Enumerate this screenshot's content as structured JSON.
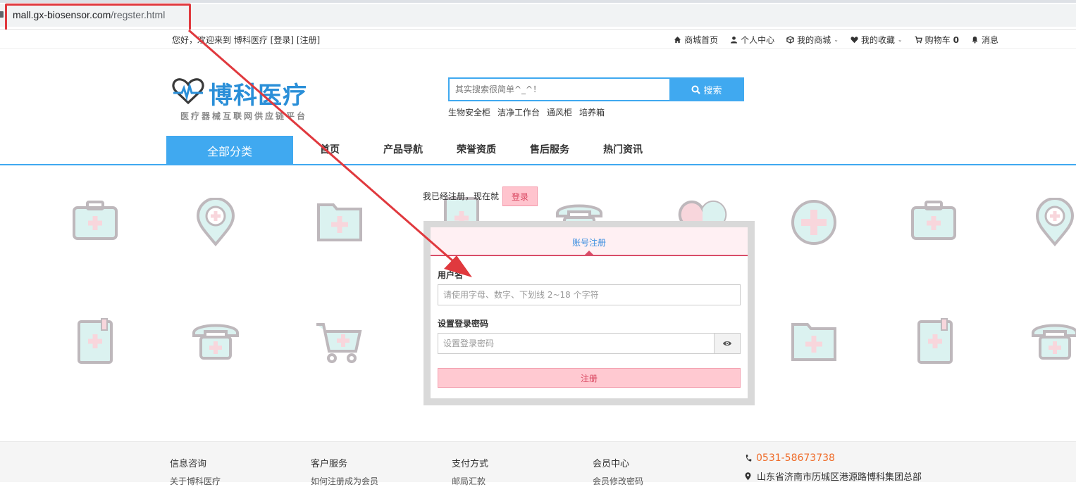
{
  "browser": {
    "url_host": "mall.gx-biosensor.com",
    "url_path": "/regster.html"
  },
  "topbar": {
    "welcome": "您好，欢迎来到 博科医疗",
    "login_link": "[登录]",
    "register_link": "[注册]",
    "nav": [
      {
        "label": "商城首页",
        "icon": "home-icon"
      },
      {
        "label": "个人中心",
        "icon": "user-icon"
      },
      {
        "label": "我的商城",
        "icon": "cube-icon"
      },
      {
        "label": "我的收藏",
        "icon": "heart-icon"
      },
      {
        "label": "购物车",
        "icon": "cart-icon",
        "count": "0"
      },
      {
        "label": "消息",
        "icon": "bell-icon"
      }
    ]
  },
  "header": {
    "logo_name": "博科医疗",
    "logo_slogan": "医疗器械互联网供应链平台",
    "search_placeholder": "其实搜索很简单^_^！",
    "search_button": "搜索",
    "hot_words": [
      "生物安全柜",
      "洁净工作台",
      "通风柜",
      "培养箱"
    ]
  },
  "nav": {
    "all_categories": "全部分类",
    "links": [
      "首页",
      "产品导航",
      "荣誉资质",
      "售后服务",
      "热门资讯"
    ]
  },
  "register": {
    "already_text": "我已经注册，现在就",
    "login_button": "登录",
    "tab": "账号注册",
    "username_label": "用户名",
    "username_placeholder": "请使用字母、数字、下划线 2~18 个字符",
    "password_label": "设置登录密码",
    "password_placeholder": "设置登录密码",
    "submit": "注册"
  },
  "footer": {
    "columns": [
      {
        "title": "信息咨询",
        "first_link": "关于博科医疗"
      },
      {
        "title": "客户服务",
        "first_link": "如何注册成为会员"
      },
      {
        "title": "支付方式",
        "first_link": "邮局汇款"
      },
      {
        "title": "会员中心",
        "first_link": "会员修改密码"
      }
    ],
    "phone": "0531-58673738",
    "address": "山东省济南市历城区港源路博科集团总部"
  },
  "colors": {
    "accent": "#40a9f0",
    "pink": "#ffc9d1",
    "annotation": "#e0393e"
  }
}
